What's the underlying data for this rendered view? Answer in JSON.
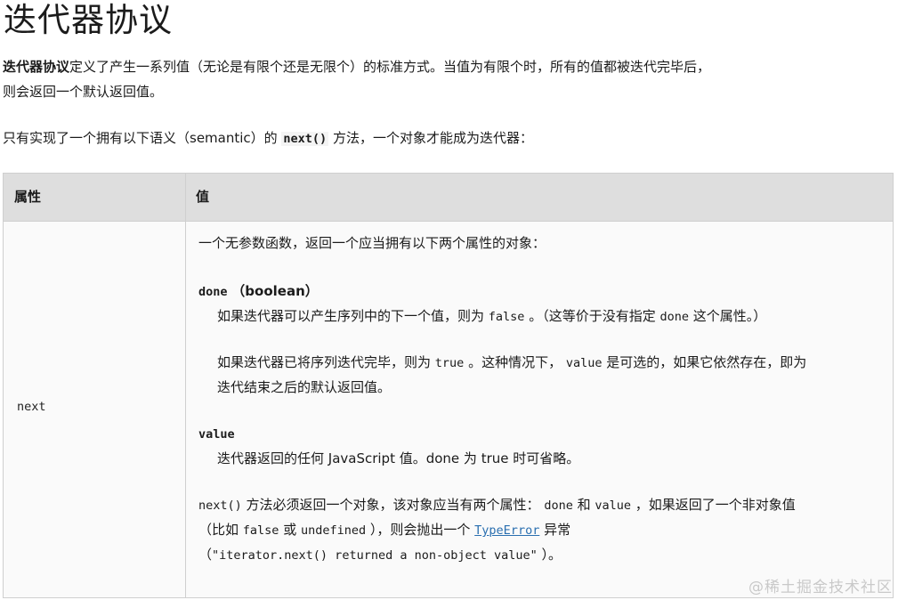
{
  "title": "迭代器协议",
  "intro": {
    "bold_term": "迭代器协议",
    "text": "定义了产生一系列值（无论是有限个还是无限个）的标准方式。当值为有限个时，所有的值都被迭代完毕后，则会返回一个默认返回值。"
  },
  "requirement": {
    "before": "只有实现了一个拥有以下语义（semantic）的 ",
    "code": "next()",
    "after": " 方法，一个对象才能成为迭代器："
  },
  "table": {
    "headers": [
      "属性",
      "值"
    ],
    "row": {
      "key": "next",
      "desc": "一个无参数函数，返回一个应当拥有以下两个属性的对象：",
      "done": {
        "name": "done",
        "type": "（boolean）",
        "line1_a": "如果迭代器可以产生序列中的下一个值，则为 ",
        "line1_code": "false",
        "line1_b": " 。（这等价于没有指定 ",
        "line1_code2": "done",
        "line1_c": " 这个属性。）",
        "line2_a": "如果迭代器已将序列迭代完毕，则为 ",
        "line2_code": "true",
        "line2_b": " 。这种情况下， ",
        "line2_code2": "value",
        "line2_c": " 是可选的，如果它依然存在，即为",
        "line3": "迭代结束之后的默认返回值。"
      },
      "value": {
        "name": "value",
        "desc": "迭代器返回的任何 JavaScript 值。done 为 true 时可省略。"
      },
      "note": {
        "code_next": "next()",
        "a": " 方法必须返回一个对象，该对象应当有两个属性： ",
        "code_done": "done",
        "b": " 和 ",
        "code_value": "value",
        "c": " ，如果返回了一个非对象值",
        "d": "（比如 ",
        "code_false": "false",
        "e": " 或 ",
        "code_undefined": "undefined",
        "f": " ），则会抛出一个 ",
        "link": "TypeError",
        "g": " 异常",
        "h": "（",
        "code_msg": "\"iterator.next() returned a non-object value\"",
        "i": " ）。"
      }
    }
  },
  "watermark": "@稀土掘金技术社区",
  "colors": {
    "header_bg": "#dedede",
    "border": "#cfcfcf",
    "link": "#2a6fb0"
  }
}
